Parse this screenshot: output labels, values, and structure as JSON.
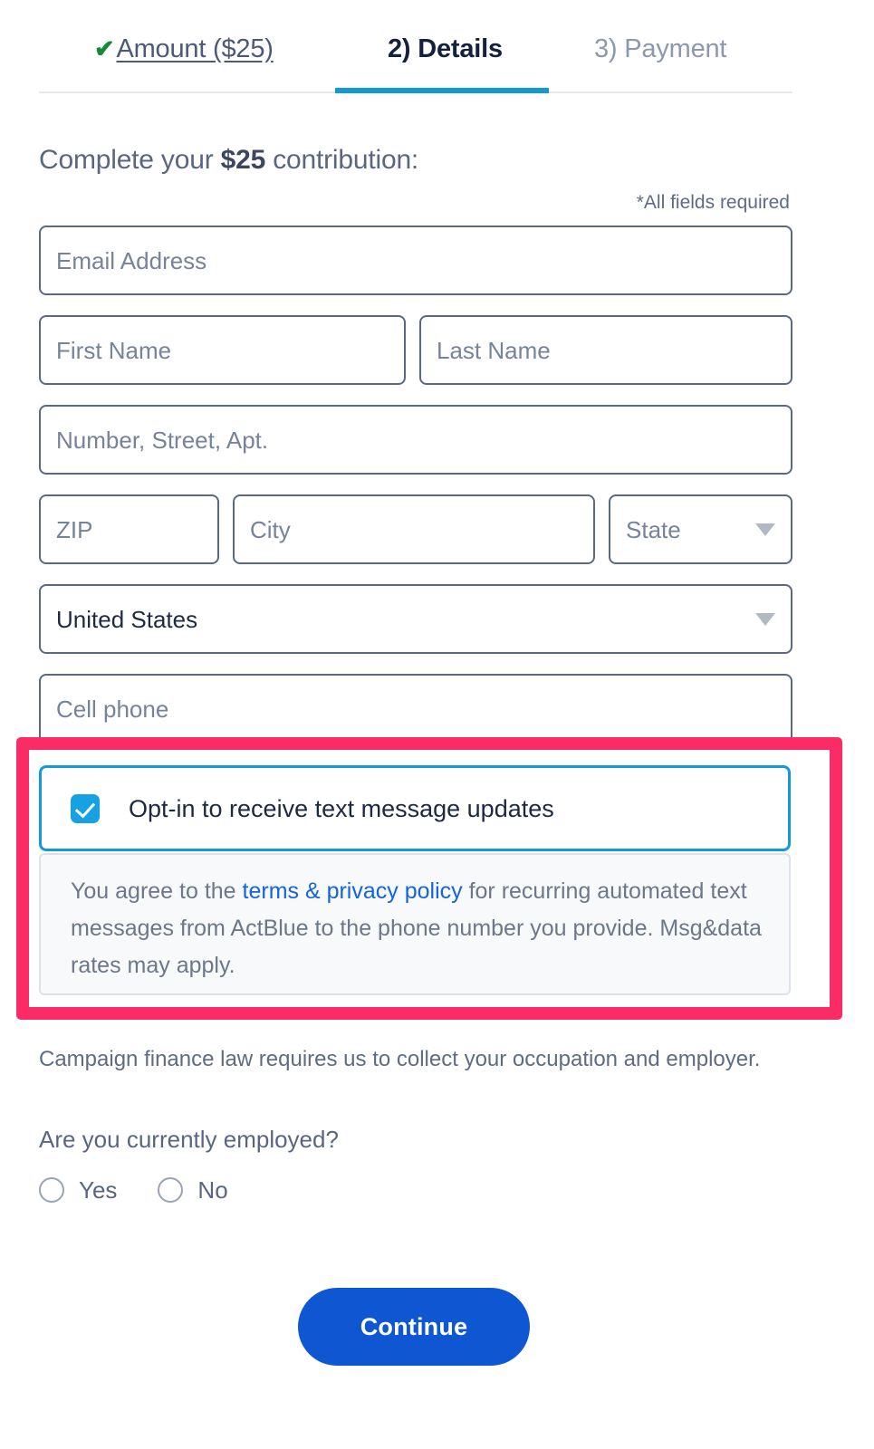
{
  "steps": {
    "items": [
      {
        "id": "amount",
        "check": "✔",
        "label": "Amount ($25)",
        "state": "completed"
      },
      {
        "id": "details",
        "label": "2) Details",
        "state": "active"
      },
      {
        "id": "payment",
        "label": "3) Payment",
        "state": "upcoming"
      }
    ]
  },
  "heading": {
    "prefix": "Complete your ",
    "amount": "$25",
    "suffix": " contribution:"
  },
  "required_note": "*All fields required",
  "fields": {
    "email": {
      "placeholder": "Email Address",
      "value": ""
    },
    "first": {
      "placeholder": "First Name",
      "value": ""
    },
    "last": {
      "placeholder": "Last Name",
      "value": ""
    },
    "street": {
      "placeholder": "Number, Street, Apt.",
      "value": ""
    },
    "zip": {
      "placeholder": "ZIP",
      "value": ""
    },
    "city": {
      "placeholder": "City",
      "value": ""
    },
    "state": {
      "placeholder": "State",
      "value": "",
      "options": [
        "State"
      ]
    },
    "country": {
      "placeholder": "",
      "value": "United States",
      "options": [
        "United States"
      ]
    },
    "cell": {
      "placeholder": "Cell phone",
      "value": ""
    }
  },
  "optin": {
    "checked": true,
    "label": "Opt-in to receive text message updates",
    "terms": {
      "before": "You agree to the ",
      "link": "terms & privacy policy",
      "after": " for recurring automated text messages from ActBlue to the phone number you provide. Msg&data rates may apply."
    }
  },
  "occupation": {
    "note": "Campaign finance law requires us to collect your occupation and employer.",
    "question": "Are you currently employed?",
    "options": [
      {
        "label": "Yes",
        "selected": false
      },
      {
        "label": "No",
        "selected": false
      }
    ]
  },
  "actions": {
    "continue_label": "Continue"
  },
  "colors": {
    "accent_blue": "#139ad6",
    "button_blue": "#0f56d3",
    "link_blue": "#1463e0",
    "annotation_pink": "#fb2b66",
    "check_green": "#128a36",
    "field_border": "#5c6883",
    "placeholder": "#77829b"
  }
}
